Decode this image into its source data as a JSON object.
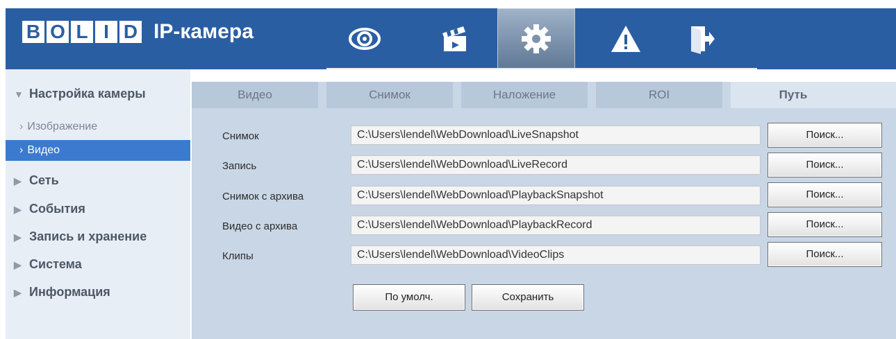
{
  "colors": {
    "header": "#2a5ea2",
    "sidebar_bg": "#e8eef6",
    "content_bg": "#c9d6e6",
    "active_item": "#3c7ad0"
  },
  "header": {
    "logo_letters": [
      "B",
      "O",
      "L",
      "I",
      "D"
    ],
    "logo_text": "BOLID",
    "app_title": "IP-камера",
    "nav": [
      {
        "icon": "eye-icon"
      },
      {
        "icon": "clapperboard-icon"
      },
      {
        "icon": "gear-icon",
        "active": true
      },
      {
        "icon": "warning-icon"
      },
      {
        "icon": "logout-icon"
      }
    ]
  },
  "sidebar": {
    "camera_settings": "Настройка камеры",
    "image": "Изображение",
    "video": "Видео",
    "network": "Сеть",
    "events": "События",
    "recording_storage": "Запись и хранение",
    "system": "Система",
    "information": "Информация"
  },
  "tabs": [
    "Видео",
    "Снимок",
    "Наложение",
    "ROI",
    "Путь"
  ],
  "active_tab": "Путь",
  "paths": [
    {
      "label": "Снимок",
      "value": "C:\\Users\\lendel\\WebDownload\\LiveSnapshot",
      "button": "Поиск..."
    },
    {
      "label": "Запись",
      "value": "C:\\Users\\lendel\\WebDownload\\LiveRecord",
      "button": "Поиск..."
    },
    {
      "label": "Снимок с архива",
      "value": "C:\\Users\\lendel\\WebDownload\\PlaybackSnapshot",
      "button": "Поиск..."
    },
    {
      "label": "Видео с архива",
      "value": "C:\\Users\\lendel\\WebDownload\\PlaybackRecord",
      "button": "Поиск..."
    },
    {
      "label": "Клипы",
      "value": "C:\\Users\\lendel\\WebDownload\\VideoClips",
      "button": "Поиск..."
    }
  ],
  "actions": {
    "default_label": "По умолч.",
    "save_label": "Сохранить"
  }
}
